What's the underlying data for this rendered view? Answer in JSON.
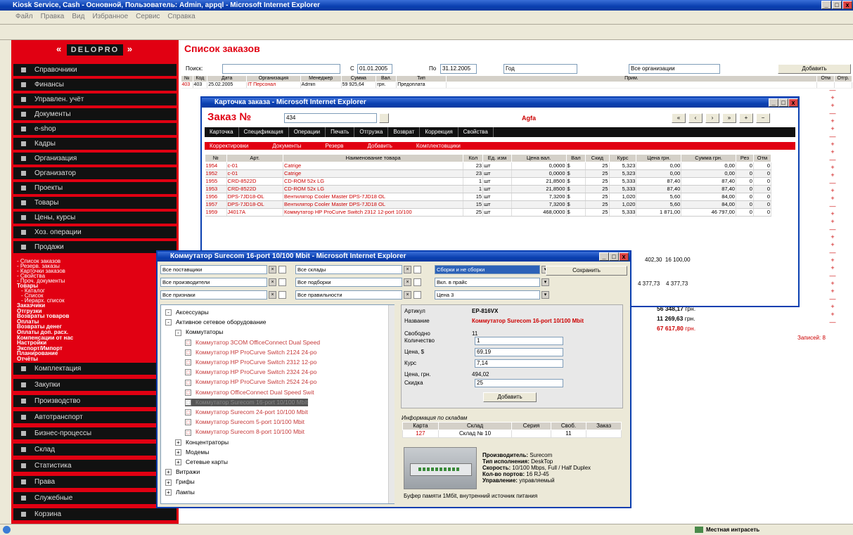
{
  "browser": {
    "title": "Kiosk Service, Cash - Основной, Пользователь: Admin, appql - Microsoft Internet Explorer",
    "menu": [
      "Файл",
      "Правка",
      "Вид",
      "Избранное",
      "Сервис",
      "Справка"
    ]
  },
  "sidebar": {
    "logo": "DELOPRO",
    "items": [
      "Справочники",
      "Финансы",
      "Управлен. учёт",
      "Документы",
      "e-shop",
      "Кадры",
      "Организация",
      "Организатор",
      "Проекты",
      "Товары",
      "Цены, курсы",
      "Хоз. операции",
      "Продажи"
    ],
    "sub": [
      "- Список заказов",
      "- Резерв. заказы",
      "- Карточки заказов",
      "- Свойства",
      "- Проч. документы"
    ],
    "sub_bold": [
      "Товары"
    ],
    "sub2": [
      "- Каталог",
      "- Список",
      "- Иерарх. список"
    ],
    "bold": [
      "Заказчики",
      "Отгрузки",
      "Возвраты товаров",
      "Оплаты",
      "Возвраты денег",
      "Оплаты доп. расх.",
      "Компенсации от нас",
      "Настройки",
      "Экспорт/Импорт",
      "Планирование",
      "Отчёты"
    ],
    "items2": [
      "Комплектация",
      "Закупки",
      "Производство",
      "Автотранспорт",
      "Бизнес-процессы",
      "Склад",
      "Статистика",
      "Права",
      "Служебные",
      "Корзина"
    ]
  },
  "main": {
    "title": "Список заказов",
    "search_label": "Поиск:",
    "from_label": "С",
    "from": "01.01.2005",
    "to_label": "По",
    "to": "31.12.2005",
    "period": "Год",
    "org": "Все организации",
    "add": "Добавить",
    "headers": [
      "№",
      "Код",
      "Дата",
      "Организация",
      "Менеджер",
      "Сумма",
      "Вал.",
      "Тип",
      "Прим.",
      "Отм",
      "Отгр."
    ],
    "rows": [
      [
        "403",
        "403",
        "25.02.2005",
        "IT Персонал",
        "Admin",
        "59 925,64",
        "грн.",
        "Предоплата"
      ]
    ],
    "totals": [
      {
        "v": "56 348,17",
        "c": "грн."
      },
      {
        "v": "11 269,63",
        "c": "грн."
      },
      {
        "v": "67 617,80",
        "c": "грн."
      }
    ],
    "counter": "Записей: 8"
  },
  "order": {
    "title": "Карточка заказа - Microsoft Internet Explorer",
    "heading": "Заказ №",
    "number": "434",
    "client": "Agfa",
    "tabs": [
      "Карточка",
      "Спецификация",
      "Операции",
      "Печать",
      "Отгрузка",
      "Возврат",
      "Коррекция",
      "Свойства"
    ],
    "subtabs": [
      "Корректировки",
      "Документы",
      "Резерв",
      "Добавить",
      "Комплектовщики"
    ],
    "headers": [
      "№",
      "Арт.",
      "Наименование товара",
      "Кол",
      "Ед. изм",
      "Цена вал.",
      "Вал",
      "Скид",
      "Курс",
      "Цена грн.",
      "Сумма грн.",
      "Рез",
      "Отм"
    ],
    "rows": [
      [
        "1954",
        "c-01",
        "Catrige",
        "23",
        "шт",
        "0,0000",
        "$",
        "25",
        "5,323",
        "0,00",
        "0,00",
        "0",
        "0"
      ],
      [
        "1952",
        "c-01",
        "Catrige",
        "23",
        "шт",
        "0,0000",
        "$",
        "25",
        "5,323",
        "0,00",
        "0,00",
        "0",
        "0"
      ],
      [
        "1955",
        "CRD-8522D",
        "CD-ROM 52x LG",
        "1",
        "шт",
        "21,8500",
        "$",
        "25",
        "5,333",
        "87,40",
        "87,40",
        "0",
        "0"
      ],
      [
        "1953",
        "CRD-8522D",
        "CD-ROM 52x LG",
        "1",
        "шт",
        "21,8500",
        "$",
        "25",
        "5,333",
        "87,40",
        "87,40",
        "0",
        "0"
      ],
      [
        "1956",
        "DPS-7JD18-OL",
        "Вентилятор Cooler Master DPS-7JD18 OL",
        "15",
        "шт",
        "7,3200",
        "$",
        "25",
        "1,020",
        "5,60",
        "84,00",
        "0",
        "0"
      ],
      [
        "1957",
        "DPS-7JD18-OL",
        "Вентилятор Cooler Master DPS-7JD18 OL",
        "15",
        "шт",
        "7,3200",
        "$",
        "25",
        "1,020",
        "5,60",
        "84,00",
        "0",
        "0"
      ],
      [
        "1959",
        "J4017A",
        "Коммутатор HP ProCurve Switch 2312 12-port 10/100",
        "25",
        "шт",
        "468,0000",
        "$",
        "25",
        "5,333",
        "1 871,00",
        "46 797,00",
        "0",
        "0"
      ]
    ],
    "extra": [
      "402,30",
      "16 100,00",
      "4 377,73",
      "4 377,73"
    ]
  },
  "switch": {
    "title": "Коммутатор Surecom 16-port 10/100 Mbit - Microsoft Internet Explorer",
    "filters": [
      "Все поставщики",
      "Все производители",
      "Все признаки",
      "Все склады",
      "Все подборки",
      "Все правильности",
      "Сборки и не сборки",
      "Вкл. в прайс",
      "Цена 3"
    ],
    "save": "Сохранить",
    "tree": [
      [
        "-",
        "Аксессуары",
        0,
        0
      ],
      [
        "-",
        "Активное сетевое оборудование",
        0,
        0
      ],
      [
        "-",
        "Коммутаторы",
        1,
        0
      ],
      [
        "□",
        "Коммутатор 3COM OfficeConnect Dual Speed",
        2,
        1
      ],
      [
        "□",
        "Коммутатор HP ProCurve Switch 2124 24-po",
        2,
        1
      ],
      [
        "□",
        "Коммутатор HP ProCurve Switch 2312 12-po",
        2,
        1
      ],
      [
        "□",
        "Коммутатор HP ProCurve Switch 2324 24-po",
        2,
        1
      ],
      [
        "□",
        "Коммутатор HP ProCurve Switch 2524 24-po",
        2,
        1
      ],
      [
        "□",
        "Коммутатор OfficeConnect Dual Speed Swit",
        2,
        1
      ],
      [
        "□",
        "Коммутатор Surecom 16-port 10/100 Mbit",
        2,
        2
      ],
      [
        "□",
        "Коммутатор Surecom 24-port 10/100 Mbit",
        2,
        1
      ],
      [
        "□",
        "Коммутатор Surecom 5-port 10/100 Mbit",
        2,
        1
      ],
      [
        "□",
        "Коммутатор Surecom 8-port 10/100 Mbit",
        2,
        1
      ],
      [
        "+",
        "Концентраторы",
        1,
        0
      ],
      [
        "+",
        "Модемы",
        1,
        0
      ],
      [
        "+",
        "Сетевые карты",
        1,
        0
      ],
      [
        "+",
        "Витражи",
        0,
        0
      ],
      [
        "+",
        "Грифы",
        0,
        0
      ],
      [
        "+",
        "Лампы",
        0,
        0
      ]
    ],
    "props": {
      "article_l": "Артикул",
      "article": "EP-816VX",
      "name_l": "Название",
      "name": "Коммутатор Surecom 16-port 10/100 Mbit",
      "free_l": "Свободно",
      "free": "11",
      "qty_l": "Количество",
      "qty": "1",
      "price_l": "Цена, $",
      "price": "69,19",
      "rate_l": "Курс",
      "rate": "7,14",
      "uah_l": "Цена, грн.",
      "uah": "494,02",
      "disc_l": "Скидка",
      "disc": "25",
      "add": "Добавить"
    },
    "stock_title": "Информация по складам",
    "stock_headers": [
      "Карта",
      "Склад",
      "Серия",
      "Своб.",
      "Заказ"
    ],
    "stock_row": [
      "127",
      "Склад № 10",
      "",
      "11",
      ""
    ],
    "desc": [
      [
        "Производитель:",
        "Surecom"
      ],
      [
        "Тип исполнения:",
        "DeskTop"
      ],
      [
        "Скорость:",
        "10/100 Mbps, Full / Half Duplex"
      ],
      [
        "Кол-во портов:",
        "16 RJ-45"
      ],
      [
        "Управление:",
        "управляемый"
      ]
    ],
    "desc2": "Буфер памяти 1Мбit, внутренний источник питания"
  },
  "status": {
    "zone": "Местная интрасеть"
  }
}
